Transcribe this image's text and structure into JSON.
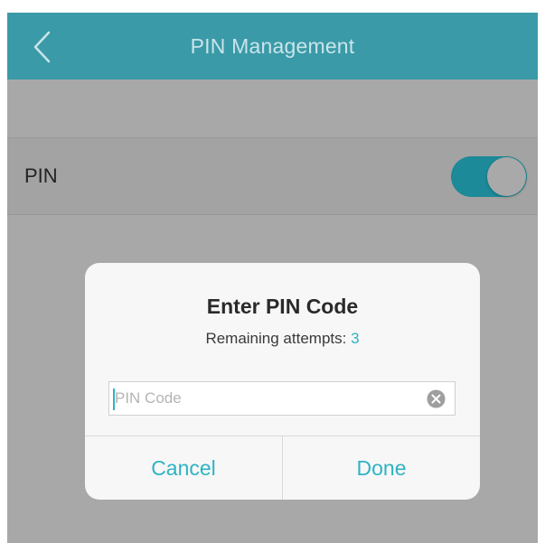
{
  "header": {
    "title": "PIN Management",
    "back_icon": "chevron-left-icon"
  },
  "settings": {
    "pin_label": "PIN",
    "pin_enabled": true
  },
  "dialog": {
    "title": "Enter PIN Code",
    "subtitle_prefix": "Remaining attempts: ",
    "remaining_attempts": "3",
    "input_placeholder": "PIN Code",
    "input_value": "",
    "clear_icon": "clear-x-icon",
    "cancel_label": "Cancel",
    "done_label": "Done"
  },
  "colors": {
    "accent": "#2fb3c4",
    "navbar": "#3b9aa8",
    "overlay_bg": "#a8a8a8",
    "toggle_on": "#1c8a99"
  }
}
